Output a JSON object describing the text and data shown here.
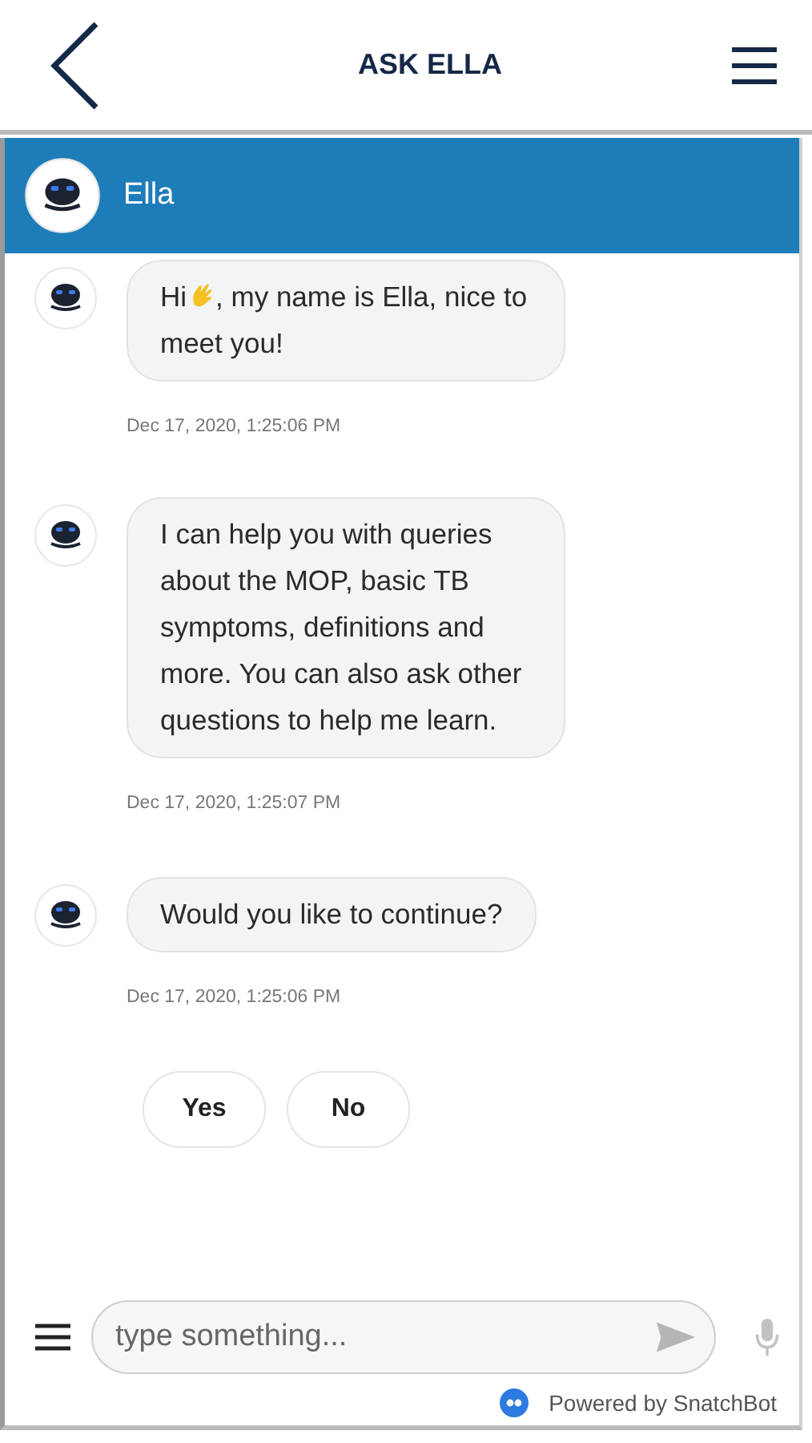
{
  "app_bar": {
    "title": "ASK ELLA"
  },
  "chat_header": {
    "name": "Ella"
  },
  "messages": [
    {
      "text_before": "Hi",
      "text_after": ", my name is Ella, nice to meet you!",
      "wave": true,
      "timestamp": "Dec 17, 2020, 1:25:06 PM"
    },
    {
      "text_before": "I can help you with queries about the MOP, basic TB symptoms, definitions and more. You can also ask other questions to help me learn.",
      "wave": false,
      "timestamp": "Dec 17, 2020, 1:25:07 PM"
    },
    {
      "text_before": "Would you like to continue?",
      "wave": false,
      "timestamp": "Dec 17, 2020, 1:25:06 PM"
    }
  ],
  "quick_replies": [
    "Yes",
    "No"
  ],
  "composer": {
    "placeholder": "type something..."
  },
  "footer": {
    "powered_by": "Powered by SnatchBot"
  }
}
